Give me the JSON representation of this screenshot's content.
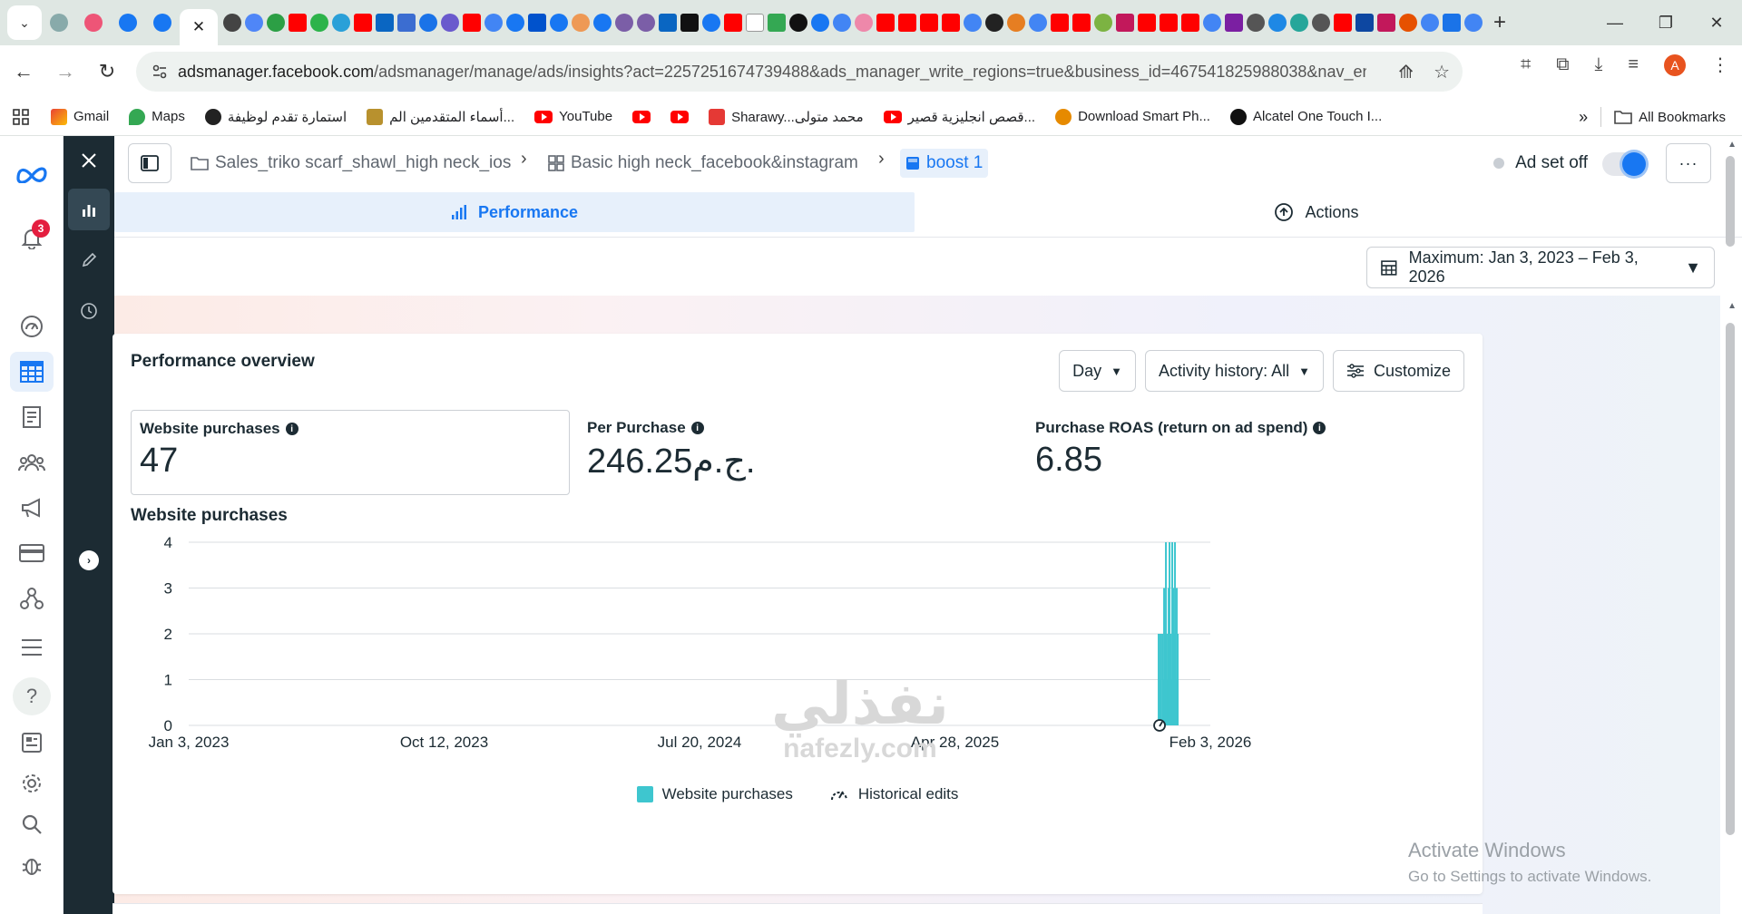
{
  "browser": {
    "close_tab_glyph": "✕",
    "url_host": "adsmanager.facebook.com",
    "url_path": "/adsmanager/manage/ads/insights?act=2257251674739488&ads_manager_write_regions=true&business_id=467541825988038&nav_entry_p...",
    "profile_initial": "A",
    "bookmarks": [
      {
        "label": "Gmail",
        "icon": "gmail-icon"
      },
      {
        "label": "Maps",
        "icon": "maps-icon"
      },
      {
        "label": "استمارة تقدم لوظيفة",
        "icon": "globe-icon"
      },
      {
        "label": "أسماء المتقدمين الم...",
        "icon": "egypt-emblem-icon"
      },
      {
        "label": "YouTube",
        "icon": "youtube-icon"
      },
      {
        "label": "",
        "icon": "youtube-icon"
      },
      {
        "label": "",
        "icon": "youtube-icon"
      },
      {
        "label": "Sharawy...محمد متولى",
        "icon": "video-icon"
      },
      {
        "label": "قصص انجليزية قصير...",
        "icon": "youtube-icon"
      },
      {
        "label": "Download Smart Ph...",
        "icon": "download-site-icon"
      },
      {
        "label": "Alcatel One Touch I...",
        "icon": "alcatel-icon"
      }
    ],
    "all_bookmarks": "All Bookmarks"
  },
  "leftnav": {
    "notification_count": "3",
    "help_glyph": "?"
  },
  "breadcrumb": {
    "campaign": "Sales_triko scarf_shawl_high neck_ios",
    "adset": "Basic high neck_facebook&instagram",
    "ad": "boost 1"
  },
  "adset_status": "Ad set off",
  "tabs": {
    "performance": "Performance",
    "actions": "Actions"
  },
  "date_range": "Maximum: Jan 3, 2023 – Feb 3, 2026",
  "overview": {
    "title": "Performance overview",
    "granularity": "Day",
    "activity_history": "Activity history: All",
    "customize": "Customize",
    "metrics": [
      {
        "label": "Website purchases",
        "value": "47"
      },
      {
        "label": "Per Purchase",
        "value": "246.25ج.م."
      },
      {
        "label": "Purchase ROAS (return on ad spend)",
        "value": "6.85"
      }
    ]
  },
  "chart_data": {
    "type": "bar",
    "title": "Website purchases",
    "xlabel": "",
    "ylabel": "",
    "ylim": [
      0,
      4
    ],
    "y_ticks": [
      "0",
      "1",
      "2",
      "3",
      "4"
    ],
    "x_tick_labels": [
      "Jan 3, 2023",
      "Oct 12, 2023",
      "Jul 20, 2024",
      "Apr 28, 2025",
      "Feb 3, 2026"
    ],
    "x_range": [
      "2023-01-03",
      "2026-02-03"
    ],
    "grid": true,
    "series": [
      {
        "name": "Website purchases",
        "color": "#3ec6cf",
        "x": [
          "2025-12-08",
          "2025-12-09",
          "2025-12-10",
          "2025-12-11",
          "2025-12-12",
          "2025-12-13",
          "2025-12-14",
          "2025-12-15",
          "2025-12-16",
          "2025-12-17",
          "2025-12-18",
          "2025-12-19",
          "2025-12-20",
          "2025-12-21",
          "2025-12-22",
          "2025-12-23",
          "2025-12-24",
          "2025-12-25",
          "2025-12-26",
          "2025-12-27",
          "2025-12-28",
          "2025-12-29",
          "2025-12-30"
        ],
        "values": [
          2,
          1,
          2,
          0,
          2,
          1,
          3,
          2,
          4,
          1,
          2,
          3,
          4,
          2,
          1,
          4,
          3,
          2,
          4,
          1,
          3,
          2,
          0
        ]
      }
    ],
    "historical_edits": [
      "2025-12-09"
    ],
    "legend": [
      "Website purchases",
      "Historical edits"
    ],
    "legend_position": "bottom"
  },
  "watermark": {
    "activate_title": "Activate Windows",
    "activate_sub": "Go to Settings to activate Windows.",
    "brand_ar": "نفذلي",
    "brand_lat": "nafezly.com"
  }
}
